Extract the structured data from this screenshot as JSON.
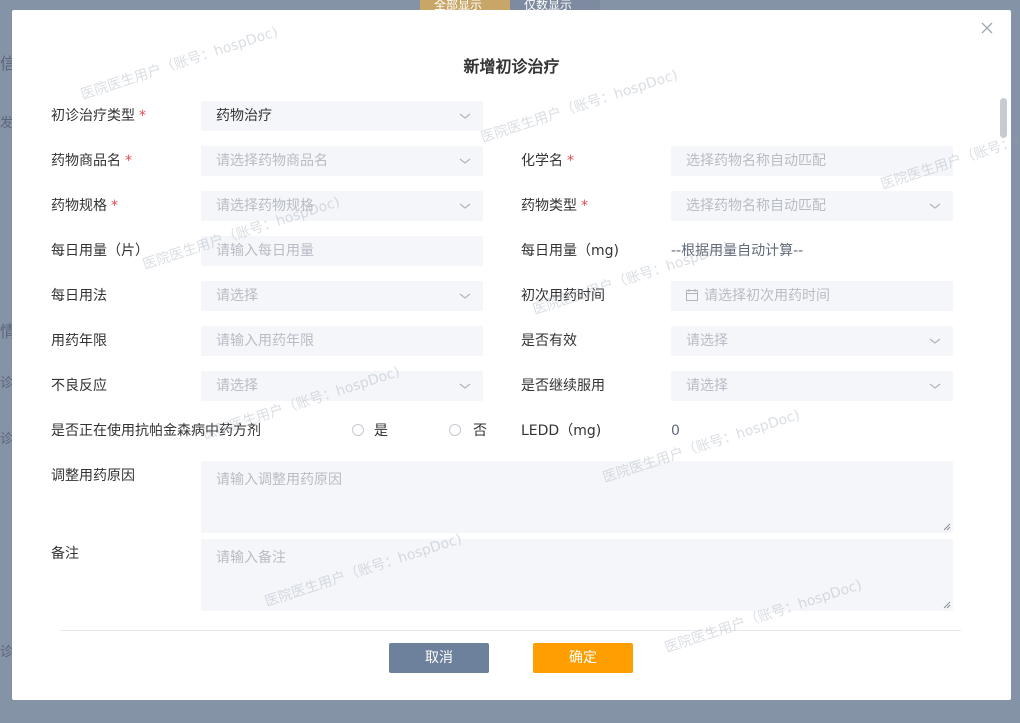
{
  "background": {
    "tabs": [
      "全部显示",
      "仅数显示"
    ],
    "side_chars": [
      "信",
      "发",
      "情",
      "诊",
      "诊",
      "诊"
    ]
  },
  "modal": {
    "title": "新增初诊治疗",
    "close_icon": "close-icon",
    "required_mark": "*",
    "fields": {
      "treatment_type": {
        "label": "初诊治疗类型",
        "value": "药物治疗"
      },
      "drug_name": {
        "label": "药物商品名",
        "placeholder": "请选择药物商品名"
      },
      "chemical_name": {
        "label": "化学名",
        "placeholder": "选择药物名称自动匹配"
      },
      "drug_spec": {
        "label": "药物规格",
        "placeholder": "请选择药物规格"
      },
      "drug_type": {
        "label": "药物类型",
        "placeholder": "选择药物名称自动匹配"
      },
      "daily_dose_tablet": {
        "label": "每日用量（片）",
        "placeholder": "请输入每日用量"
      },
      "daily_dose_mg": {
        "label": "每日用量（mg)",
        "value": "--根据用量自动计算--"
      },
      "daily_usage": {
        "label": "每日用法",
        "placeholder": "请选择"
      },
      "first_time": {
        "label": "初次用药时间",
        "placeholder": "请选择初次用药时间"
      },
      "years": {
        "label": "用药年限",
        "placeholder": "请输入用药年限"
      },
      "effective": {
        "label": "是否有效",
        "placeholder": "请选择"
      },
      "adverse": {
        "label": "不良反应",
        "placeholder": "请选择"
      },
      "continue": {
        "label": "是否继续服用",
        "placeholder": "请选择"
      },
      "tcm": {
        "label": "是否正在使用抗帕金森病中药方剂",
        "options": [
          "是",
          "否"
        ]
      },
      "ledd": {
        "label": "LEDD（mg)",
        "value": "0"
      },
      "adjust_reason": {
        "label": "调整用药原因",
        "placeholder": "请输入调整用药原因"
      },
      "remark": {
        "label": "备注",
        "placeholder": "请输入备注"
      }
    },
    "buttons": {
      "cancel": "取消",
      "ok": "确定"
    }
  },
  "watermark": "医院医生用户（账号：hospDoc)"
}
